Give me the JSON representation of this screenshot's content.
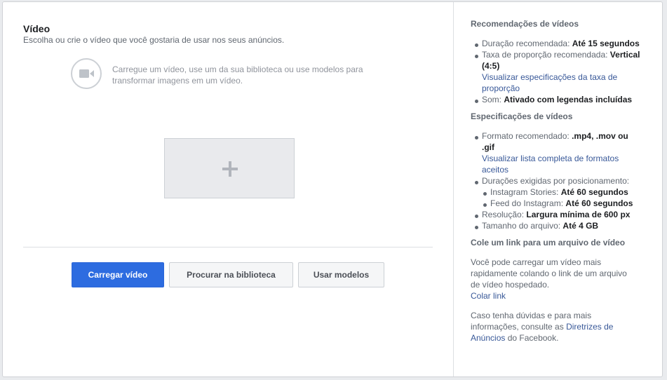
{
  "main": {
    "title": "Vídeo",
    "subtitle": "Escolha ou crie o vídeo que você gostaria de usar nos seus anúncios.",
    "helper_text": "Carregue um vídeo, use um da sua biblioteca ou use modelos para transformar imagens em um vídeo.",
    "icons": {
      "camera": "video-camera-icon",
      "plus": "plus-icon"
    },
    "buttons": {
      "upload": "Carregar vídeo",
      "library": "Procurar na biblioteca",
      "templates": "Usar modelos"
    },
    "colors": {
      "primary": "#2d6ce0",
      "link": "#385898"
    }
  },
  "sidebar": {
    "recommendations": {
      "title": "Recomendações de vídeos",
      "duration_label": "Duração recomendada:",
      "duration_value": "Até 15 segundos",
      "ratio_label": "Taxa de proporção recomendada:",
      "ratio_value": "Vertical (4:5)",
      "ratio_link": "Visualizar especificações da taxa de proporção",
      "sound_label": "Som:",
      "sound_value": "Ativado com legendas incluídas"
    },
    "specs": {
      "title": "Especificações de vídeos",
      "format_label": "Formato recomendado:",
      "format_value": ".mp4, .mov ou .gif",
      "format_link": "Visualizar lista completa de formatos aceitos",
      "placement_label": "Durações exigidas por posicionamento:",
      "stories_label": "Instagram Stories:",
      "stories_value": "Até 60 segundos",
      "feed_label": "Feed do Instagram:",
      "feed_value": "Até 60 segundos",
      "resolution_label": "Resolução:",
      "resolution_value": "Largura mínima de 600 px",
      "size_label": "Tamanho do arquivo:",
      "size_value": "Até 4 GB"
    },
    "paste_link": {
      "title": "Cole um link para um arquivo de vídeo",
      "text": "Você pode carregar um vídeo mais rapidamente colando o link de um arquivo de vídeo hospedado.",
      "link": "Colar link"
    },
    "help": {
      "text_before": "Caso tenha dúvidas e para mais informações, consulte as",
      "link": "Diretrizes de Anúncios",
      "text_after": "do Facebook."
    }
  }
}
